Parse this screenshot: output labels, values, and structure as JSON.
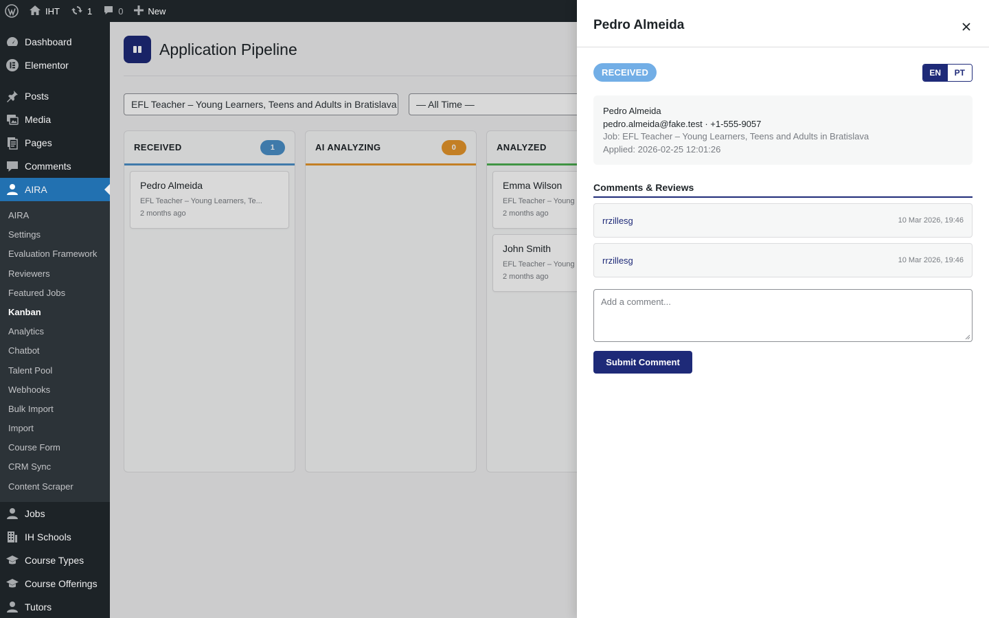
{
  "adminbar": {
    "site_name": "IHT",
    "updates_count": "1",
    "comments_count": "0",
    "new_label": "New"
  },
  "sidebar": {
    "top_items": [
      {
        "label": "Dashboard",
        "icon": "dashboard-icon"
      },
      {
        "label": "Elementor",
        "icon": "elementor-icon"
      }
    ],
    "items": [
      {
        "label": "Posts",
        "icon": "pin-icon"
      },
      {
        "label": "Media",
        "icon": "media-icon"
      },
      {
        "label": "Pages",
        "icon": "pages-icon"
      },
      {
        "label": "Comments",
        "icon": "comments-icon"
      },
      {
        "label": "AIRA",
        "icon": "user-icon"
      }
    ],
    "aira_submenu": [
      "AIRA",
      "Settings",
      "Evaluation Framework",
      "Reviewers",
      "Featured Jobs",
      "Kanban",
      "Analytics",
      "Chatbot",
      "Talent Pool",
      "Webhooks",
      "Bulk Import",
      "Import",
      "Course Form",
      "CRM Sync",
      "Content Scraper"
    ],
    "active_submenu": "Kanban",
    "bottom_items": [
      {
        "label": "Jobs",
        "icon": "user-icon"
      },
      {
        "label": "IH Schools",
        "icon": "building-icon"
      },
      {
        "label": "Course Types",
        "icon": "graduation-icon"
      },
      {
        "label": "Course Offerings",
        "icon": "graduation-icon"
      },
      {
        "label": "Tutors",
        "icon": "user-icon"
      }
    ]
  },
  "page": {
    "title": "Application Pipeline",
    "job_filter": "EFL Teacher – Young Learners, Teens and Adults in Bratislava",
    "time_filter": "— All Time —"
  },
  "columns": [
    {
      "title": "RECEIVED",
      "count": "1",
      "color": "#4a90c8",
      "cards": [
        {
          "name": "Pedro Almeida",
          "job": "EFL Teacher – Young Learners, Te...",
          "time": "2 months ago"
        }
      ]
    },
    {
      "title": "AI ANALYZING",
      "count": "0",
      "color": "#e5962b",
      "cards": []
    },
    {
      "title": "ANALYZED",
      "count": "",
      "color": "#4caf50",
      "cards": [
        {
          "name": "Emma Wilson",
          "job": "EFL Teacher – Young Le",
          "time": "2 months ago"
        },
        {
          "name": "John Smith",
          "job": "EFL Teacher – Young Le",
          "time": "2 months ago"
        }
      ]
    }
  ],
  "panel": {
    "title": "Pedro Almeida",
    "status": "RECEIVED",
    "lang_en": "EN",
    "lang_pt": "PT",
    "info": {
      "name": "Pedro Almeida",
      "contact": "pedro.almeida@fake.test · +1-555-9057",
      "job": "Job: EFL Teacher – Young Learners, Teens and Adults in Bratislava",
      "applied": "Applied: 2026-02-25 12:01:26"
    },
    "comments_title": "Comments & Reviews",
    "comments": [
      {
        "author": "rrzillesg",
        "date": "10 Mar 2026, 19:46"
      },
      {
        "author": "rrzillesg",
        "date": "10 Mar 2026, 19:46"
      }
    ],
    "comment_placeholder": "Add a comment...",
    "submit_label": "Submit Comment"
  }
}
